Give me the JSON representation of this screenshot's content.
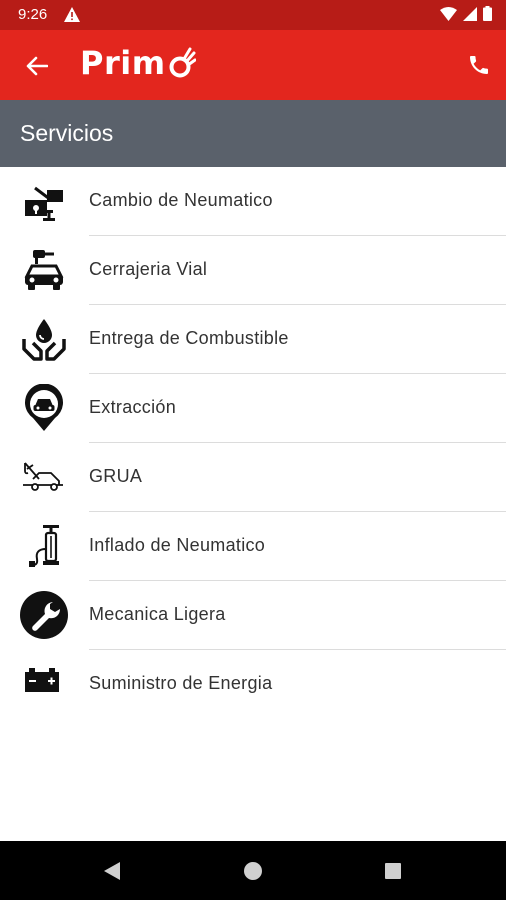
{
  "status_bar": {
    "time": "9:26",
    "icons": [
      "warning-icon",
      "wifi-icon",
      "signal-icon",
      "battery-icon"
    ]
  },
  "app_bar": {
    "logo_text": "Prim",
    "back_icon": "arrow-left-icon",
    "call_icon": "phone-icon",
    "background_color": "#e3261e"
  },
  "section": {
    "title": "Servicios",
    "background_color": "#5a616b"
  },
  "services": [
    {
      "label": "Cambio de Neumatico",
      "icon": "tire-change-icon"
    },
    {
      "label": "Cerrajeria Vial",
      "icon": "car-key-icon"
    },
    {
      "label": "Entrega de Combustible",
      "icon": "fuel-delivery-icon"
    },
    {
      "label": "Extracción",
      "icon": "car-pin-icon"
    },
    {
      "label": "GRUA",
      "icon": "tow-truck-icon"
    },
    {
      "label": "Inflado de Neumatico",
      "icon": "air-pump-icon"
    },
    {
      "label": "Mecanica Ligera",
      "icon": "wrench-icon"
    },
    {
      "label": "Suministro de Energia",
      "icon": "battery-icon"
    }
  ],
  "nav_bar": {
    "icons": [
      "back-triangle-icon",
      "home-circle-icon",
      "recents-square-icon"
    ]
  }
}
